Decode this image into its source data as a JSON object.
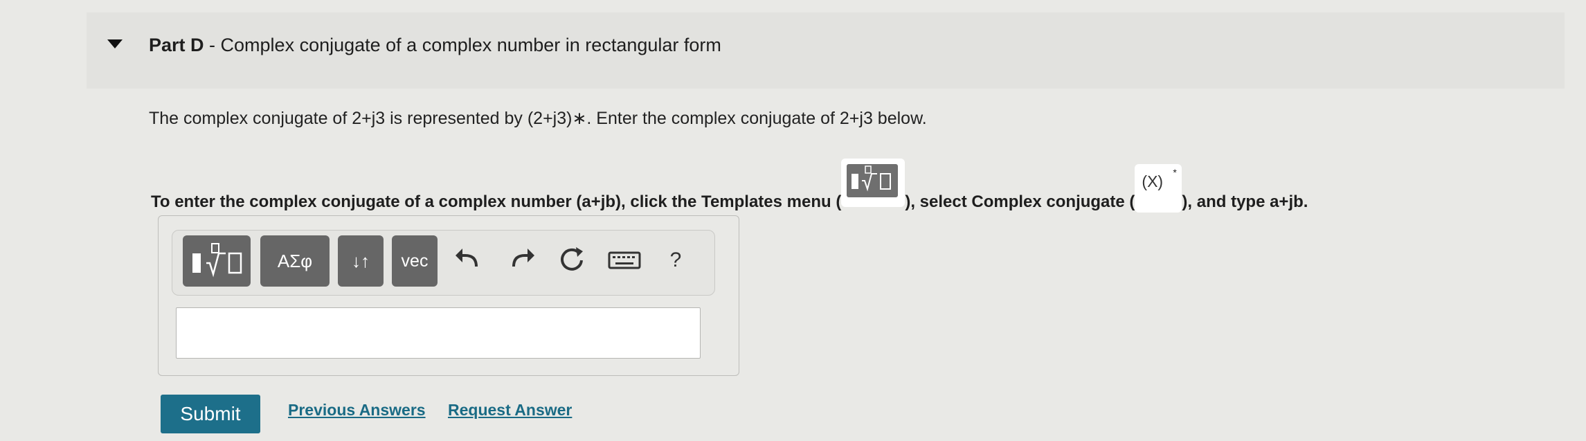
{
  "part": {
    "label": "Part D",
    "separator": " - ",
    "title": "Complex conjugate of a complex number in rectangular form"
  },
  "question": {
    "text": "The complex conjugate of 2+j3 is represented by (2+j3)∗. Enter the complex conjugate of 2+j3 below."
  },
  "instruction": {
    "part1": "To enter the complex conjugate of a complex number (a+jb), click the Templates menu (",
    "part2": "), select Complex conjugate (",
    "part3": "), and type a+jb.",
    "conjugate_symbol": "(X)",
    "conjugate_star": "*"
  },
  "toolbar": {
    "symbols_label": "ΑΣφ",
    "arrows_label": "↓↑",
    "vec_label": "vec",
    "help_label": "?"
  },
  "answer": {
    "value": "",
    "placeholder": ""
  },
  "actions": {
    "submit_label": "Submit",
    "previous_answers_label": "Previous Answers",
    "request_answer_label": "Request Answer"
  },
  "colors": {
    "background": "#e9e9e6",
    "header_band": "#e2e2df",
    "submit": "#1d6f8a",
    "link": "#1a6b85",
    "toolbar_button": "#666666"
  },
  "icons": [
    "collapse-triangle-icon",
    "templates-icon",
    "undo-icon",
    "redo-icon",
    "reset-icon",
    "keyboard-icon",
    "help-icon"
  ]
}
